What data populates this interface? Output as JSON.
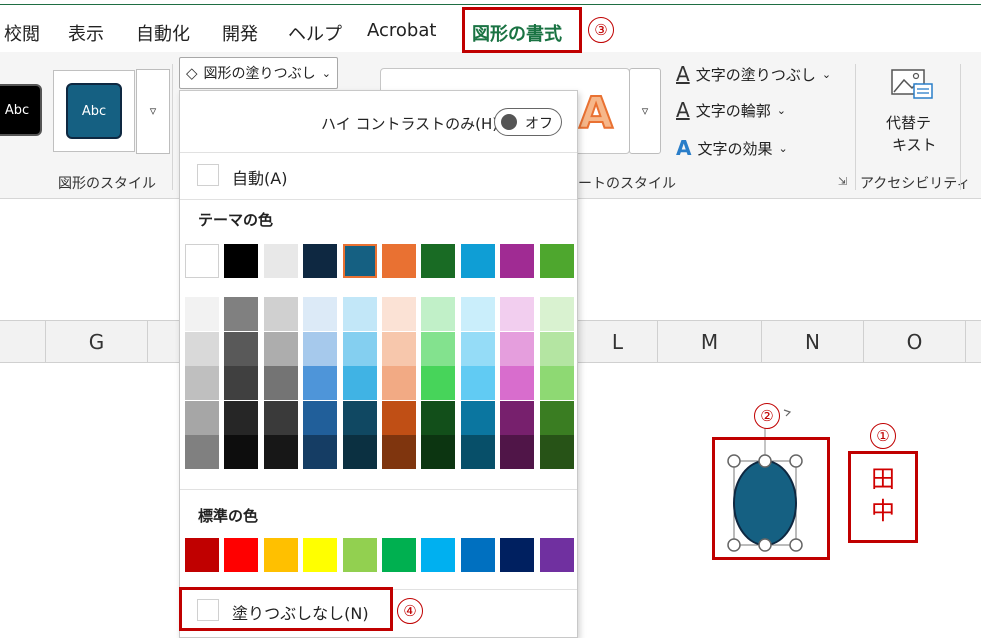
{
  "menu": {
    "items": [
      "校閲",
      "表示",
      "自動化",
      "開発",
      "ヘルプ",
      "Acrobat"
    ],
    "active_tab": "図形の書式"
  },
  "ribbon": {
    "shape_styles": {
      "thumb1_label": "Abc",
      "thumb2_label": "Abc",
      "group_label": "図形のスタイル"
    },
    "fill_button": "図形の塗りつぶし",
    "wordart": {
      "group_label_partial": "ートのスタイル",
      "text_fill": "文字の塗りつぶし",
      "text_outline": "文字の輪郭",
      "text_effects": "文字の効果"
    },
    "accessibility": {
      "alt_text_line1": "代替テ",
      "alt_text_line2": "キスト",
      "group_label": "アクセシビリティ"
    }
  },
  "columns": [
    "G",
    "L",
    "M",
    "N",
    "O"
  ],
  "dropdown": {
    "high_contrast_label": "ハイ コントラストのみ(H)",
    "toggle_label": "オフ",
    "automatic": "自動(A)",
    "theme_colors_title": "テーマの色",
    "standard_colors_title": "標準の色",
    "no_fill": "塗りつぶしなし(N)",
    "theme_colors": [
      "#FFFFFF",
      "#000000",
      "#E8E8E8",
      "#0E2841",
      "#156082",
      "#E97132",
      "#196B24",
      "#0F9ED5",
      "#A02B93",
      "#4EA72E"
    ],
    "theme_shades": [
      [
        "#F2F2F2",
        "#D9D9D9",
        "#BFBFBF",
        "#A6A6A6",
        "#808080"
      ],
      [
        "#808080",
        "#595959",
        "#404040",
        "#262626",
        "#0D0D0D"
      ],
      [
        "#D0D0D0",
        "#ADADAD",
        "#747474",
        "#3A3A3A",
        "#171717"
      ],
      [
        "#DCEAF7",
        "#A6C9EC",
        "#4E95D9",
        "#215F9A",
        "#153D64"
      ],
      [
        "#C2E7F8",
        "#84CFF0",
        "#40B3E4",
        "#104862",
        "#0B3041"
      ],
      [
        "#FBE2D5",
        "#F7C7AC",
        "#F2AA84",
        "#C04F15",
        "#7F350E"
      ],
      [
        "#C1F0C8",
        "#83E28E",
        "#47D45A",
        "#124F1A",
        "#0C3511"
      ],
      [
        "#CAEEFB",
        "#95DCF7",
        "#61CBF3",
        "#0B76A0",
        "#074F69"
      ],
      [
        "#F2CEEF",
        "#E59EDD",
        "#D86DCD",
        "#77206D",
        "#501548"
      ],
      [
        "#D9F2D0",
        "#B4E5A2",
        "#8ED973",
        "#3A7D22",
        "#275317"
      ]
    ],
    "standard_colors": [
      "#C00000",
      "#FF0000",
      "#FFC000",
      "#FFFF00",
      "#92D050",
      "#00B050",
      "#00B0F0",
      "#0070C0",
      "#002060",
      "#7030A0"
    ]
  },
  "shape": {
    "fill": "#156082"
  },
  "signature": {
    "char1": "田",
    "char2": "中"
  },
  "annotations": [
    "①",
    "②",
    "③",
    "④"
  ]
}
